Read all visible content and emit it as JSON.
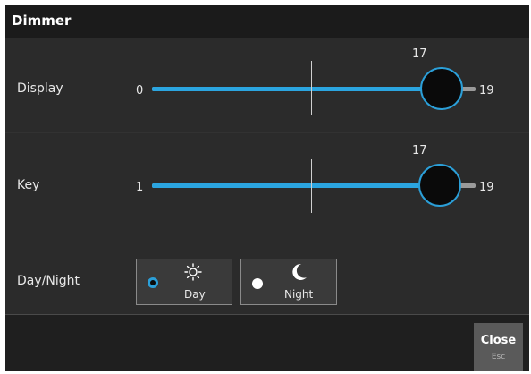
{
  "window": {
    "title": "Dimmer"
  },
  "display": {
    "label": "Display",
    "min": "0",
    "max": "19",
    "current": "17",
    "fraction": 0.895
  },
  "key": {
    "label": "Key",
    "min": "1",
    "max": "19",
    "current": "17",
    "fraction": 0.889
  },
  "day_night": {
    "label": "Day/Night",
    "day_label": "Day",
    "night_label": "Night",
    "selected": "Day"
  },
  "footer": {
    "close_label": "Close",
    "close_hint": "Esc"
  },
  "colors": {
    "accent": "#2ba5e0",
    "background": "#2b2b2b",
    "titlebar": "#1b1b1b"
  },
  "icons": {
    "day": "sun-icon",
    "night": "moon-icon"
  }
}
